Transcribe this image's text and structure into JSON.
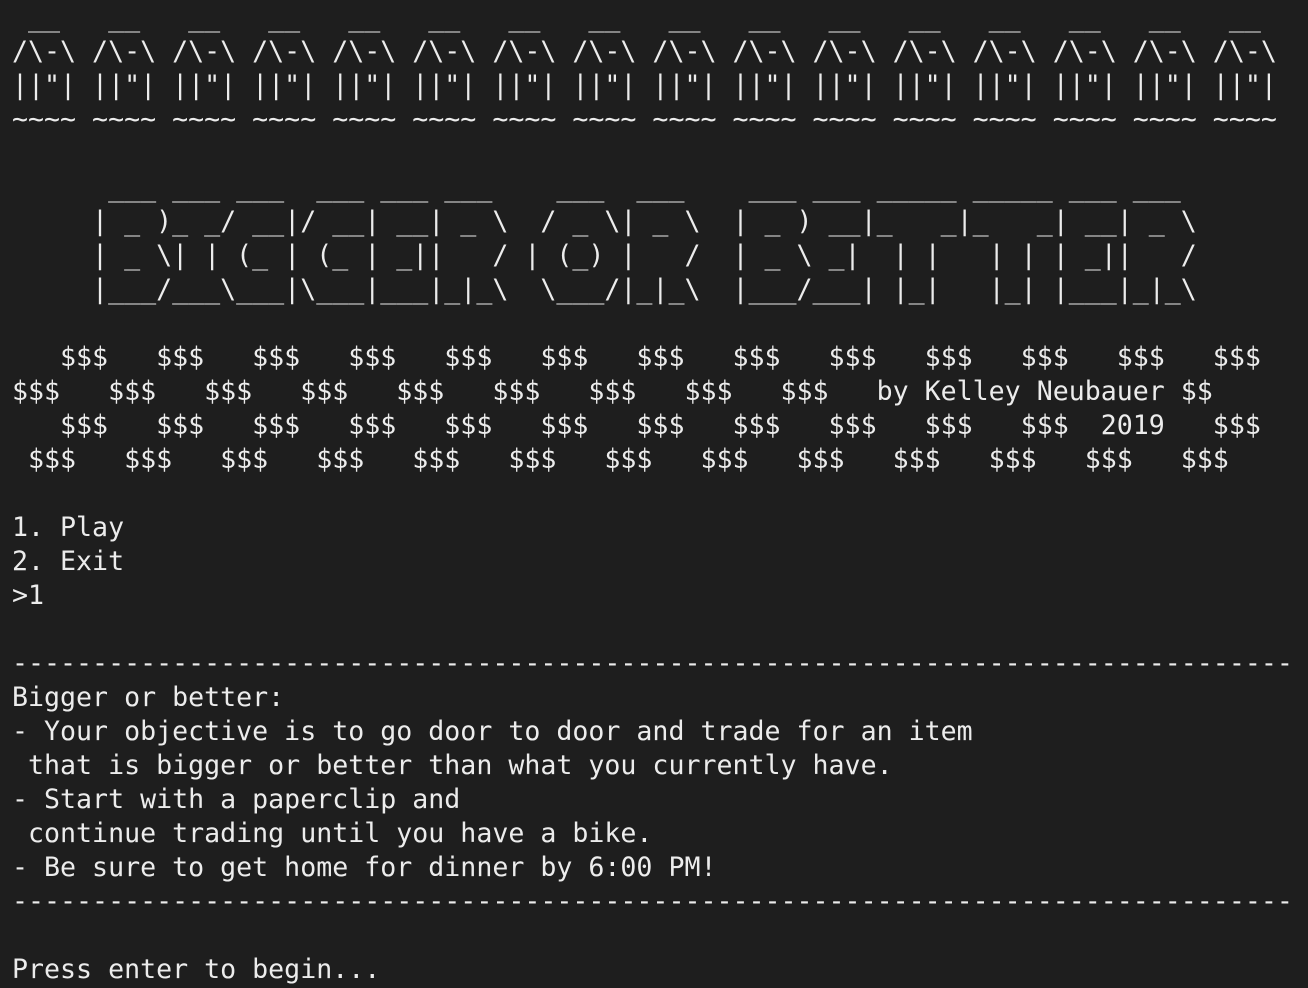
{
  "terminal": {
    "banner_top": [
      " __   __   __   __   __   __   __   __   __   __   __   __   __   __   __   __",
      "/\\-\\ /\\-\\ /\\-\\ /\\-\\ /\\-\\ /\\-\\ /\\-\\ /\\-\\ /\\-\\ /\\-\\ /\\-\\ /\\-\\ /\\-\\ /\\-\\ /\\-\\ /\\-\\",
      "||\"| ||\"| ||\"| ||\"| ||\"| ||\"| ||\"| ||\"| ||\"| ||\"| ||\"| ||\"| ||\"| ||\"| ||\"| ||\"|",
      "~~~~ ~~~~ ~~~~ ~~~~ ~~~~ ~~~~ ~~~~ ~~~~ ~~~~ ~~~~ ~~~~ ~~~~ ~~~~ ~~~~ ~~~~ ~~~~"
    ],
    "title_art": [
      "      ___ ___ ___  ___ ___ ___    ___  ___    ___ ___ _____ _____ ___ ___",
      "     | _ )_ _/ __|/ __| __| _ \\  / _ \\| _ \\  | _ ) __|_   _|_   _| __| _ \\",
      "     | _ \\| | (_ | (_ | _||   / | (_) |   /  | _ \\ _|  | |   | | | _||   /",
      "     |___/___\\___|\\___|___|_|_\\  \\___/|_|_\\  |___/___| |_|   |_| |___|_|_\\"
    ],
    "money_art": [
      "   $$$   $$$   $$$   $$$   $$$   $$$   $$$   $$$   $$$   $$$   $$$   $$$   $$$",
      "$$$   $$$   $$$   $$$   $$$   $$$   $$$   $$$   $$$   by Kelley Neubauer $$",
      "   $$$   $$$   $$$   $$$   $$$   $$$   $$$   $$$   $$$   $$$   $$$  2019   $$$",
      " $$$   $$$   $$$   $$$   $$$   $$$   $$$   $$$   $$$   $$$   $$$   $$$   $$$"
    ],
    "menu": {
      "option_play": "1. Play",
      "option_exit": "2. Exit",
      "input_line": ">1"
    },
    "rule": "--------------------------------------------------------------------------------",
    "instructions": [
      "Bigger or better:",
      "- Your objective is to go door to door and trade for an item",
      " that is bigger or better than what you currently have.",
      "- Start with a paperclip and",
      " continue trading until you have a bike.",
      "- Be sure to get home for dinner by 6:00 PM!"
    ],
    "prompt": "Press enter to begin..."
  }
}
